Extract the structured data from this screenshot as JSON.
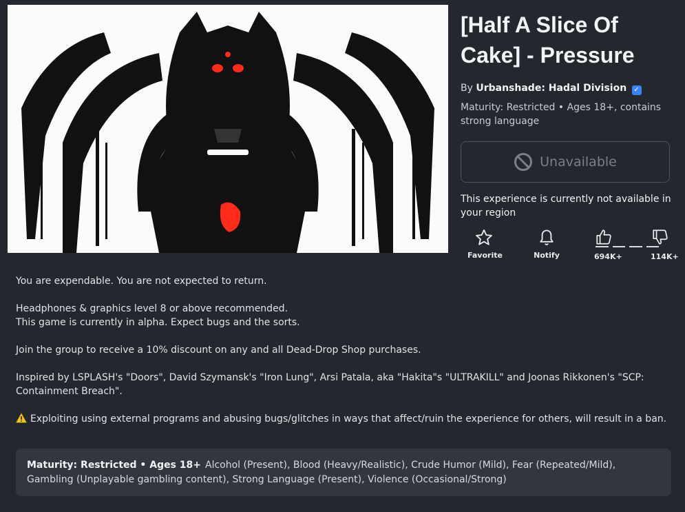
{
  "thumbnail": {
    "icon": "game-thumbnail-art"
  },
  "game": {
    "title": "[Half A Slice Of Cake] - Pressure",
    "by_label": "By",
    "creator": "Urbanshade: Hadal Division",
    "verified_icon": "verified-badge-icon",
    "maturity": "Maturity: Restricted • Ages 18+, contains strong language"
  },
  "play_button": {
    "label": "Unavailable",
    "icon": "ban-icon"
  },
  "region_note": "This experience is currently not available in your region",
  "actions": {
    "favorite": {
      "label": "Favorite",
      "icon": "star-icon"
    },
    "notify": {
      "label": "Notify",
      "icon": "bell-icon"
    },
    "upvotes": {
      "count": "694K+",
      "icon": "thumbs-up-icon"
    },
    "downvotes": {
      "count": "114K+",
      "icon": "thumbs-down-icon"
    }
  },
  "description": {
    "p1": "You are expendable. You are not expected to return.",
    "p2a": "Headphones & graphics level 8 or above recommended.",
    "p2b": "This game is currently in alpha. Expect bugs and the sorts.",
    "p3": "Join the group to receive a 10% discount on any and all Dead-Drop Shop purchases.",
    "p4": "Inspired by LSPLASH's \"Doors\", David Szymansk's \"Iron Lung\", Arsi Patala, aka \"Hakita\"s \"ULTRAKILL\" and Joonas Rikkonen's \"SCP: Containment Breach\".",
    "p5": "Exploiting using external programs and abusing bugs/glitches in ways that affect/ruin the experience for others, will result in a ban.",
    "warning_icon": "warning-icon"
  },
  "content_rating": {
    "label": "Maturity: Restricted • Ages 18+",
    "details": "Alcohol (Present), Blood (Heavy/Realistic), Crude Humor (Mild), Fear (Repeated/Mild), Gambling (Unplayable gambling content), Strong Language (Present), Violence (Occasional/Strong)"
  },
  "colors": {
    "background": "#25272e",
    "panel": "#33363e",
    "accent_blue": "#3b82f6",
    "warning_yellow": "#f5c518",
    "art_red": "#ff2a1a"
  }
}
